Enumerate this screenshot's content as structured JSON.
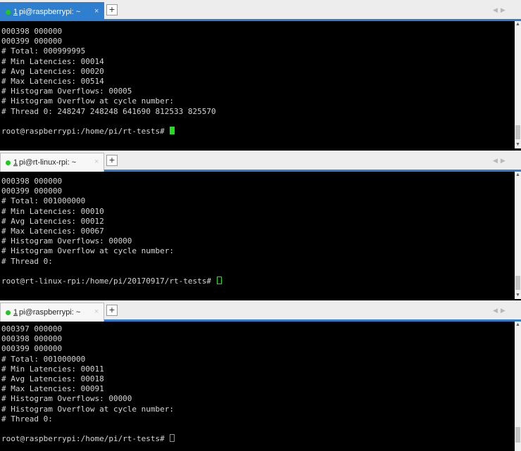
{
  "panes": [
    {
      "tab": {
        "number": "1",
        "title": "pi@raspberrypi: ~",
        "close": "×",
        "new_tab": "+"
      },
      "lines": [
        "000398 000000",
        "000399 000000",
        "# Total: 000999995",
        "# Min Latencies: 00014",
        "# Avg Latencies: 00020",
        "# Max Latencies: 00514",
        "# Histogram Overflows: 00005",
        "# Histogram Overflow at cycle number:",
        "# Thread 0: 248247 248248 641690 812533 825570",
        ""
      ],
      "prompt": "root@raspberrypi:/home/pi/rt-tests# "
    },
    {
      "tab": {
        "number": "1",
        "title": "pi@rt-linux-rpi: ~",
        "close": "×",
        "new_tab": "+"
      },
      "lines": [
        "000398 000000",
        "000399 000000",
        "# Total: 001000000",
        "# Min Latencies: 00010",
        "# Avg Latencies: 00012",
        "# Max Latencies: 00067",
        "# Histogram Overflows: 00000",
        "# Histogram Overflow at cycle number:",
        "# Thread 0:",
        ""
      ],
      "prompt": "root@rt-linux-rpi:/home/pi/20170917/rt-tests# "
    },
    {
      "tab": {
        "number": "1",
        "title": "pi@raspberrypi: ~",
        "close": "×",
        "new_tab": "+"
      },
      "lines": [
        "000397 000000",
        "000398 000000",
        "000399 000000",
        "# Total: 001000000",
        "# Min Latencies: 00011",
        "# Avg Latencies: 00018",
        "# Max Latencies: 00091",
        "# Histogram Overflows: 00000",
        "# Histogram Overflow at cycle number:",
        "# Thread 0:",
        ""
      ],
      "prompt": "root@raspberrypi:/home/pi/rt-tests# "
    }
  ],
  "colors": {
    "tab_active": "#2f7fd0",
    "status_dot": "#22c722",
    "cursor": "#1ee01e",
    "terminal_bg": "#000000",
    "terminal_fg": "#d6d6d6"
  },
  "icons": [
    "chevron-left-icon",
    "chevron-right-icon",
    "chevron-up-icon",
    "chevron-down-icon"
  ]
}
